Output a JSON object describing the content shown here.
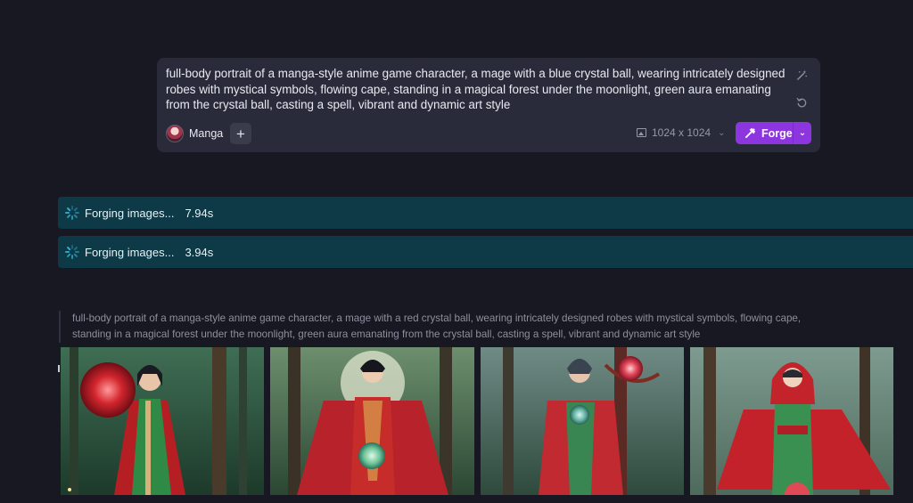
{
  "prompt_card": {
    "prompt_text": "full-body portrait of a manga-style anime game character, a mage with a blue crystal ball, wearing intricately designed robes with mystical symbols, flowing cape, standing in a magical forest under the moonlight, green aura emanating from the crystal ball, casting a spell, vibrant and dynamic art style",
    "style_label": "Manga",
    "add_label": "+",
    "size_label": "1024 x 1024",
    "forge_label": "Forge"
  },
  "progress": [
    {
      "label": "Forging images...",
      "elapsed": "7.94s"
    },
    {
      "label": "Forging images...",
      "elapsed": "3.94s"
    }
  ],
  "result": {
    "prompt_text": "full-body portrait of a manga-style anime game character, a mage with a red crystal ball, wearing intricately designed robes with mystical symbols, flowing cape, standing in a magical forest under the moonlight, green aura emanating from the crystal ball, casting a spell, vibrant and dynamic art style"
  },
  "colors": {
    "background": "#171822",
    "card": "#2a2b3a",
    "accent_purple": "#8d36e0",
    "progress_bg": "#0e3a47",
    "spinner": "#34b2d3"
  },
  "icons": [
    "magic-wand-icon",
    "undo-icon",
    "image-icon",
    "chevron-down-icon",
    "hammer-icon",
    "spinner-icon",
    "plus-icon"
  ]
}
